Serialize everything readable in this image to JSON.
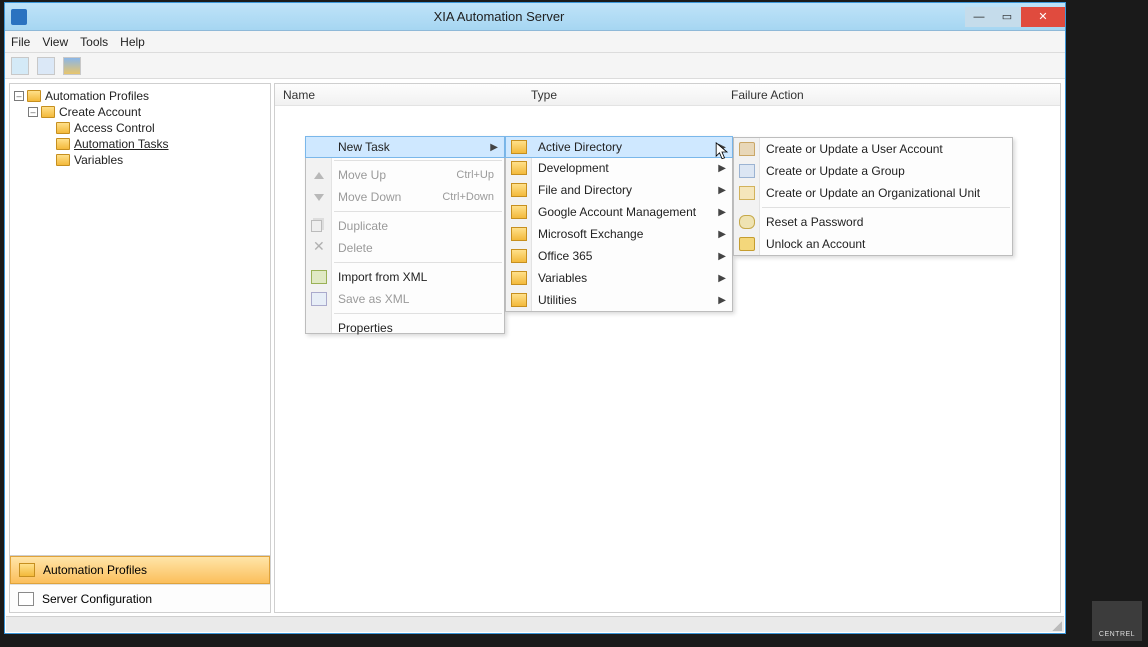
{
  "window": {
    "title": "XIA Automation Server"
  },
  "menubar": {
    "items": [
      "File",
      "View",
      "Tools",
      "Help"
    ]
  },
  "tree": {
    "root": {
      "label": "Automation Profiles",
      "children": [
        {
          "label": "Create Account",
          "children": [
            {
              "label": "Access Control"
            },
            {
              "label": "Automation Tasks",
              "selected": true
            },
            {
              "label": "Variables"
            }
          ]
        }
      ]
    }
  },
  "nav_panes": [
    {
      "label": "Automation Profiles",
      "selected": true,
      "icon": "folder"
    },
    {
      "label": "Server Configuration",
      "selected": false,
      "icon": "server"
    }
  ],
  "columns": {
    "name": "Name",
    "type": "Type",
    "failure": "Failure Action"
  },
  "context_menu": {
    "items": [
      {
        "label": "New Task",
        "submenu": true,
        "highlight": true
      },
      {
        "sep": true
      },
      {
        "label": "Move Up",
        "shortcut": "Ctrl+Up",
        "disabled": true,
        "icon": "up"
      },
      {
        "label": "Move Down",
        "shortcut": "Ctrl+Down",
        "disabled": true,
        "icon": "down"
      },
      {
        "sep": true
      },
      {
        "label": "Duplicate",
        "disabled": true,
        "icon": "dup"
      },
      {
        "label": "Delete",
        "disabled": true,
        "icon": "del"
      },
      {
        "sep": true
      },
      {
        "label": "Import from XML",
        "icon": "import"
      },
      {
        "label": "Save as XML",
        "disabled": true,
        "icon": "save"
      },
      {
        "sep": true
      },
      {
        "label": "Properties"
      }
    ]
  },
  "submenu1": {
    "items": [
      {
        "label": "Active Directory",
        "highlight": true
      },
      {
        "label": "Development"
      },
      {
        "label": "File and Directory"
      },
      {
        "label": "Google Account Management"
      },
      {
        "label": "Microsoft Exchange"
      },
      {
        "label": "Office 365"
      },
      {
        "label": "Variables"
      },
      {
        "label": "Utilities"
      }
    ]
  },
  "submenu2": {
    "items": [
      {
        "label": "Create or Update a User Account",
        "icon": "user"
      },
      {
        "label": "Create or Update a Group",
        "icon": "group"
      },
      {
        "label": "Create or Update an Organizational Unit",
        "icon": "ou"
      },
      {
        "sep": true
      },
      {
        "label": "Reset a Password",
        "icon": "key"
      },
      {
        "label": "Unlock an Account",
        "icon": "lock"
      }
    ]
  },
  "watermark": "CENTREL"
}
